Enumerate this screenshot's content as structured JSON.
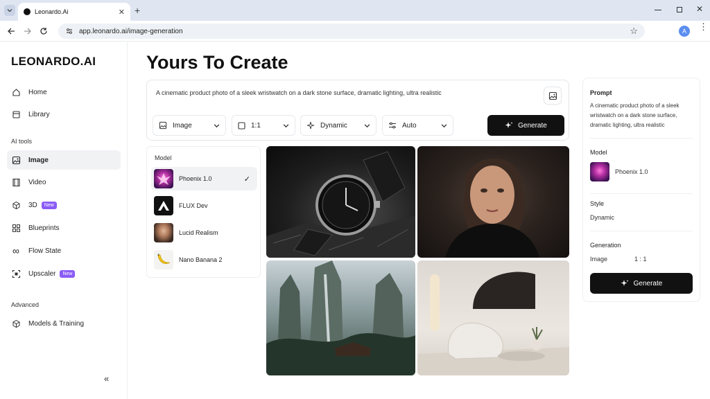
{
  "browser": {
    "tab_title": "Leonardo.Ai",
    "url": "app.leonardo.ai/image-generation",
    "profile_initial": "A"
  },
  "sidebar": {
    "logo": "LEONARDO.AI",
    "nav": [
      {
        "label": "Home"
      },
      {
        "label": "Library"
      }
    ],
    "ai_tools_label": "AI tools",
    "tools": [
      {
        "label": "Image"
      },
      {
        "label": "Video"
      },
      {
        "label": "3D",
        "badge": "New"
      },
      {
        "label": "Blueprints"
      },
      {
        "label": "Flow State"
      },
      {
        "label": "Upscaler",
        "badge": "New"
      }
    ],
    "advanced_label": "Advanced",
    "advanced": [
      {
        "label": "Models & Training"
      }
    ],
    "collapse_icon": "double-chevron-left-icon"
  },
  "main": {
    "title": "Yours To Create",
    "prompt": "A cinematic product photo of a sleek wristwatch on a dark stone surface, dramatic lighting, ultra realistic",
    "selects": [
      {
        "label": "Image",
        "icon": "image-icon"
      },
      {
        "label": "1:1",
        "icon": "square-icon"
      },
      {
        "label": "Dynamic",
        "icon": "sparkle-icon"
      },
      {
        "label": "Auto",
        "icon": "sliders-icon"
      }
    ],
    "generate_label": "Generate"
  },
  "models": {
    "heading": "Model",
    "items": [
      {
        "label": "Phoenix 1.0",
        "selected": true
      },
      {
        "label": "FLUX Dev"
      },
      {
        "label": "Lucid Realism"
      },
      {
        "label": "Nano Banana 2"
      }
    ]
  },
  "details": {
    "prompt_heading": "Prompt",
    "prompt_text": "A cinematic product photo of a sleek wristwatch on a dark stone surface, dramatic lighting, ultra realistic",
    "model_heading": "Model",
    "model_name": "Phoenix 1.0",
    "style_heading": "Style",
    "style_value": "Dynamic",
    "generation_heading": "Generation",
    "generation_type": "Image",
    "generation_ratio": "1 : 1",
    "generate_label": "Generate"
  },
  "colors": {
    "accent": "#8b5cf6",
    "button": "#111111"
  }
}
